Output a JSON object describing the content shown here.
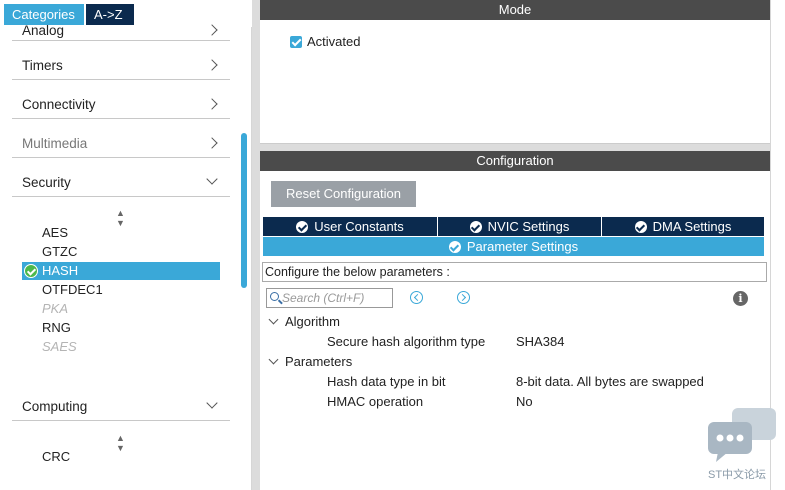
{
  "tabs": {
    "categories": "Categories",
    "az": "A->Z"
  },
  "categories": [
    {
      "label": "Analog"
    },
    {
      "label": "Timers"
    },
    {
      "label": "Connectivity"
    },
    {
      "label": "Multimedia"
    },
    {
      "label": "Security"
    },
    {
      "label": "Computing"
    }
  ],
  "security_items": [
    {
      "label": "AES"
    },
    {
      "label": "GTZC"
    },
    {
      "label": "HASH"
    },
    {
      "label": "OTFDEC1"
    },
    {
      "label": "PKA"
    },
    {
      "label": "RNG"
    },
    {
      "label": "SAES"
    }
  ],
  "computing_items": [
    {
      "label": "CRC"
    }
  ],
  "mode": {
    "title": "Mode",
    "activated_label": "Activated",
    "activated": true
  },
  "configuration": {
    "title": "Configuration",
    "reset_label": "Reset Configuration",
    "tabs": {
      "user_constants": "User Constants",
      "nvic": "NVIC Settings",
      "dma": "DMA Settings",
      "parameter": "Parameter Settings"
    },
    "hint": "Configure the below parameters :",
    "search_placeholder": "Search (Ctrl+F)",
    "groups": {
      "algorithm": {
        "label": "Algorithm",
        "params": [
          {
            "name": "Secure hash algorithm type",
            "value": "SHA384"
          }
        ]
      },
      "parameters": {
        "label": "Parameters",
        "params": [
          {
            "name": "Hash data type in bit",
            "value": "8-bit data. All bytes are swapped"
          },
          {
            "name": "HMAC operation",
            "value": "No"
          }
        ]
      }
    },
    "info_glyph": "i"
  },
  "watermark": {
    "text": "ST中文论坛"
  },
  "colors": {
    "accent": "#3aa8d8",
    "navy": "#0b2a4e",
    "bar": "#4b4b4b",
    "check_green": "#4cb84c"
  }
}
